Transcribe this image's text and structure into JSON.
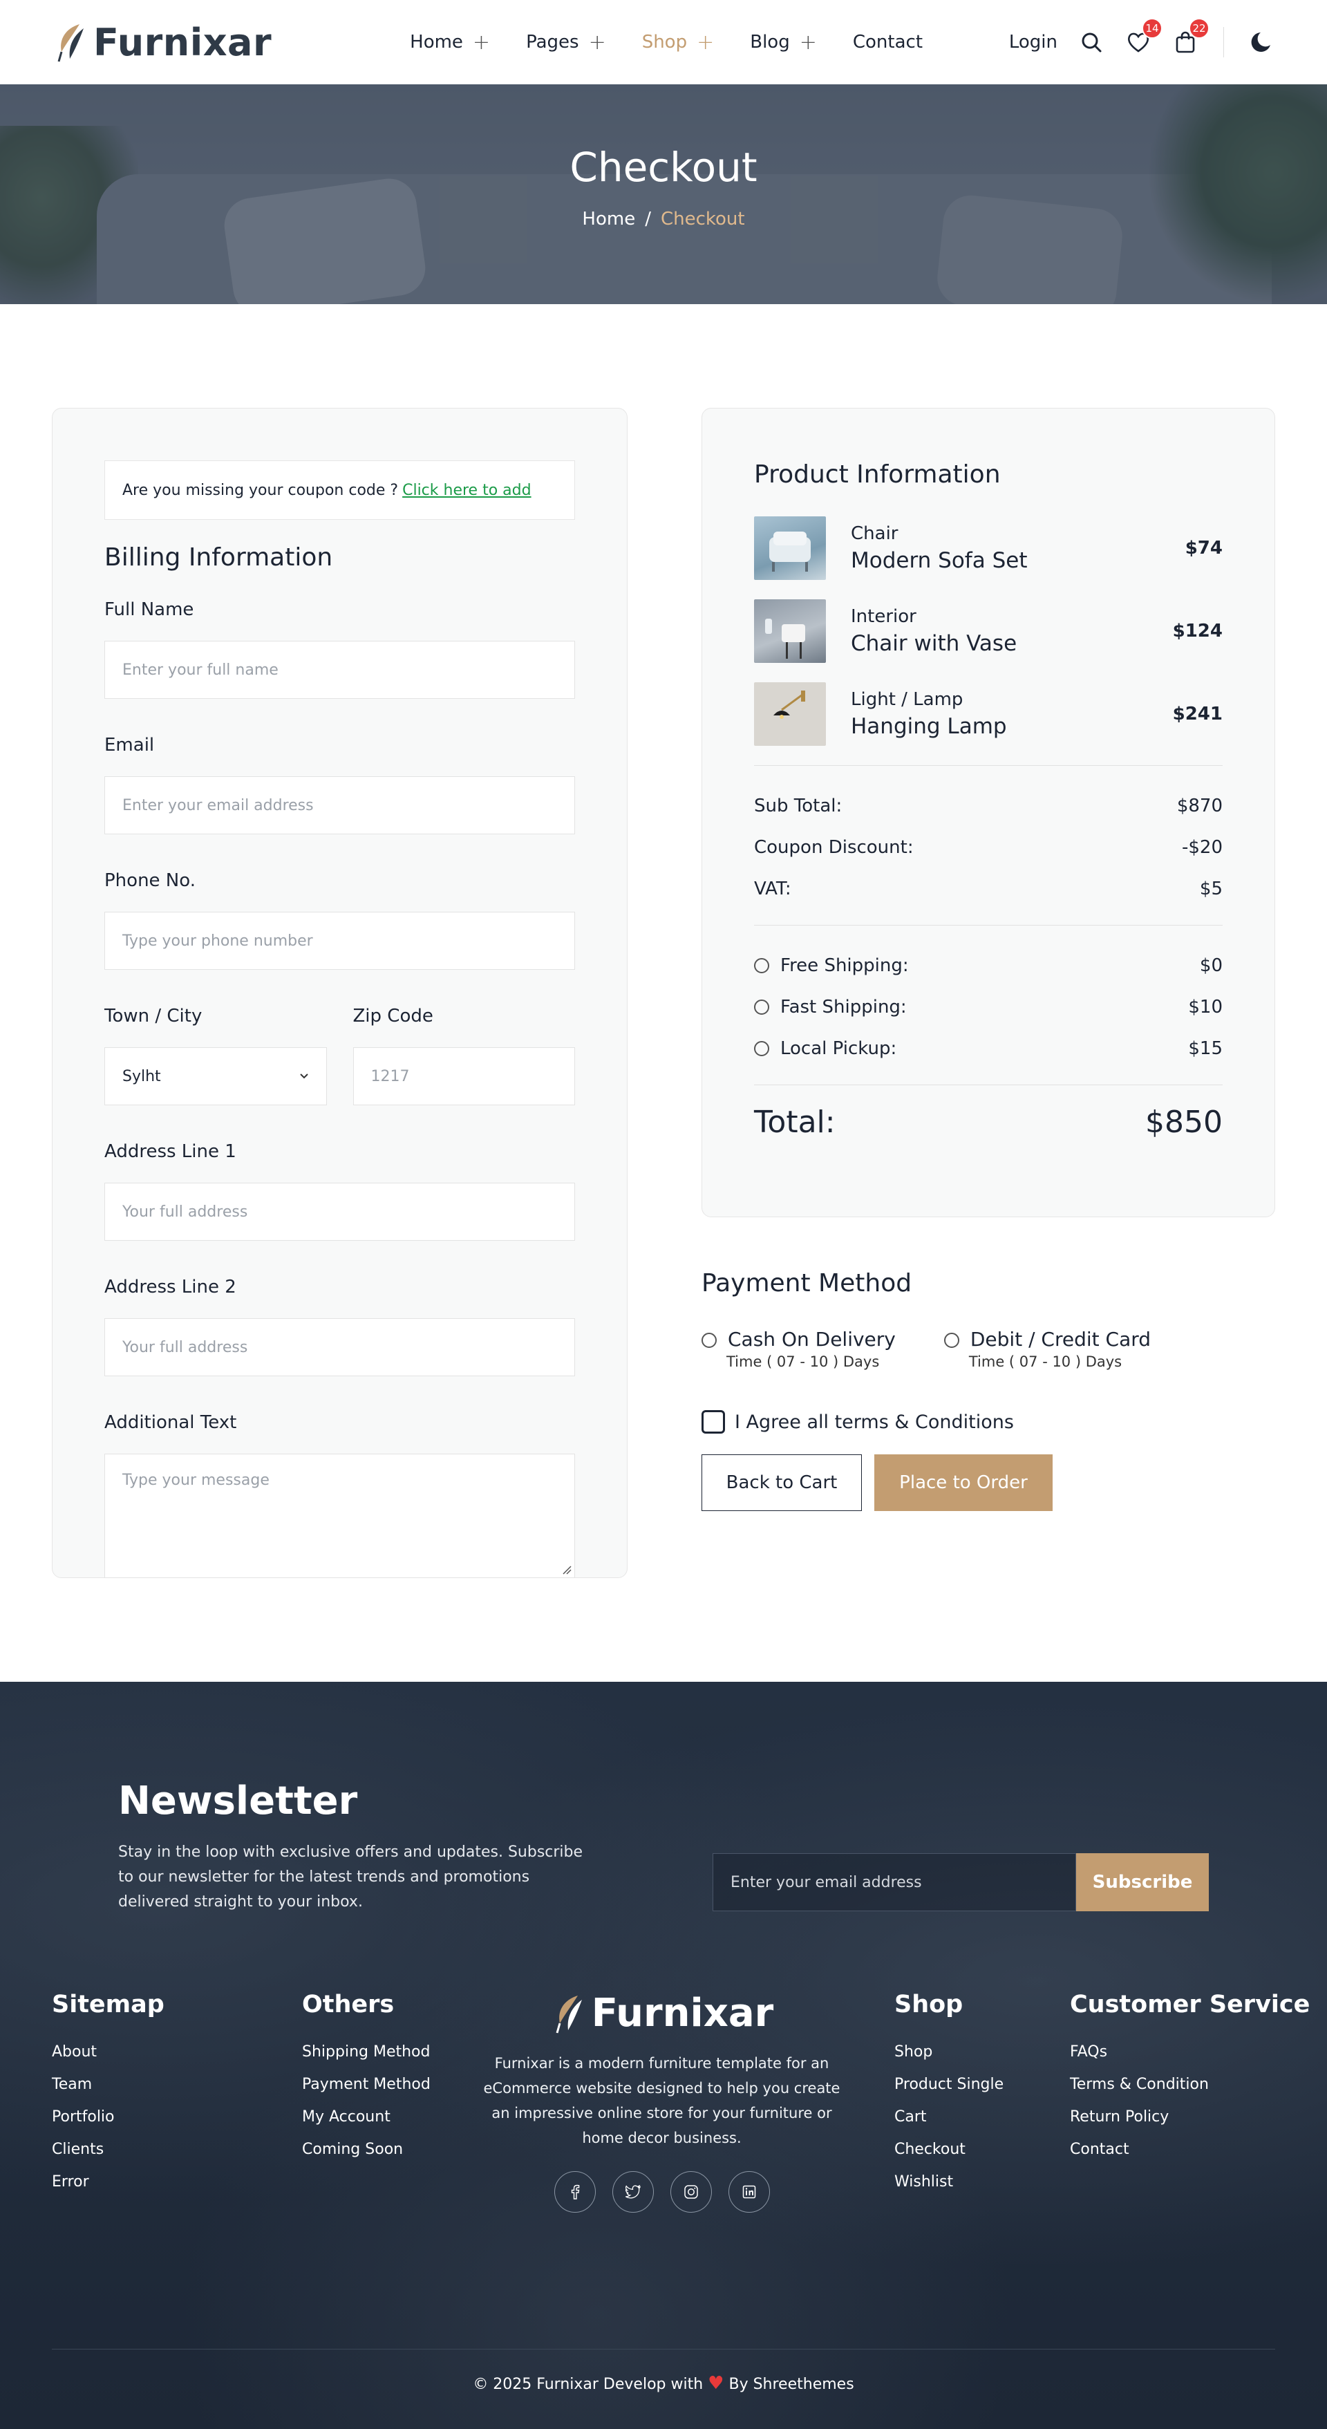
{
  "brand": {
    "name": "Furnixar"
  },
  "nav": {
    "items": [
      {
        "label": "Home",
        "has_submenu": true
      },
      {
        "label": "Pages",
        "has_submenu": true
      },
      {
        "label": "Shop",
        "has_submenu": true,
        "active": true
      },
      {
        "label": "Blog",
        "has_submenu": true
      },
      {
        "label": "Contact",
        "has_submenu": false
      }
    ],
    "login": "Login",
    "wishlist_count": "14",
    "cart_count": "22"
  },
  "hero": {
    "title": "Checkout",
    "breadcrumb_home": "Home",
    "breadcrumb_sep": "/",
    "breadcrumb_current": "Checkout"
  },
  "billing": {
    "coupon_text": "Are you missing your coupon code ?",
    "coupon_link": "Click here to add",
    "title": "Billing Information",
    "full_name_label": "Full Name",
    "full_name_placeholder": "Enter your full name",
    "email_label": "Email",
    "email_placeholder": "Enter your email address",
    "phone_label": "Phone No.",
    "phone_placeholder": "Type your phone number",
    "city_label": "Town / City",
    "city_value": "Sylht",
    "zip_label": "Zip Code",
    "zip_placeholder": "1217",
    "address1_label": "Address Line 1",
    "address1_placeholder": "Your full address",
    "address2_label": "Address Line 2",
    "address2_placeholder": "Your full address",
    "additional_label": "Additional Text",
    "additional_placeholder": "Type your message"
  },
  "summary": {
    "title": "Product Information",
    "products": [
      {
        "category": "Chair",
        "name": "Modern Sofa Set",
        "price": "$74"
      },
      {
        "category": "Interior",
        "name": "Chair with Vase",
        "price": "$124"
      },
      {
        "category": "Light / Lamp",
        "name": "Hanging Lamp",
        "price": "$241"
      }
    ],
    "subtotal_label": "Sub Total:",
    "subtotal_value": "$870",
    "coupon_label": "Coupon Discount:",
    "coupon_value": "-$20",
    "vat_label": "VAT:",
    "vat_value": "$5",
    "shipping": [
      {
        "label": "Free Shipping:",
        "value": "$0"
      },
      {
        "label": "Fast Shipping:",
        "value": "$10"
      },
      {
        "label": "Local Pickup:",
        "value": "$15"
      }
    ],
    "total_label": "Total:",
    "total_value": "$850"
  },
  "payment": {
    "title": "Payment Method",
    "options": [
      {
        "label": "Cash On Delivery",
        "sub": "Time ( 07 - 10 ) Days"
      },
      {
        "label": "Debit / Credit Card",
        "sub": "Time ( 07 - 10 ) Days"
      }
    ],
    "agree": "I Agree all terms & Conditions",
    "back_btn": "Back to Cart",
    "order_btn": "Place to Order"
  },
  "footer": {
    "newsletter_title": "Newsletter",
    "newsletter_text": "Stay in the loop with exclusive offers and updates. Subscribe to our newsletter for the latest trends and promotions delivered straight to your inbox.",
    "newsletter_placeholder": "Enter your email address",
    "subscribe": "Subscribe",
    "sitemap_title": "Sitemap",
    "sitemap": [
      "About",
      "Team",
      "Portfolio",
      "Clients",
      "Error"
    ],
    "others_title": "Others",
    "others": [
      "Shipping Method",
      "Payment Method",
      "My Account",
      "Coming Soon"
    ],
    "description": "Furnixar is a modern furniture template for an eCommerce website designed to help you create an impressive online store for your furniture or home decor business.",
    "shop_title": "Shop",
    "shop": [
      "Shop",
      "Product Single",
      "Cart",
      "Checkout",
      "Wishlist"
    ],
    "cs_title": "Customer Service",
    "cs": [
      "FAQs",
      "Terms & Condition",
      "Return Policy",
      "Contact"
    ],
    "copyright_pre": "© 2025 Furnixar Develop with",
    "copyright_post": "By Shreethemes"
  },
  "colors": {
    "accent": "#c39d71",
    "dark": "#1f2a39",
    "badge": "#e73a3a",
    "link_green": "#1b9b48"
  }
}
